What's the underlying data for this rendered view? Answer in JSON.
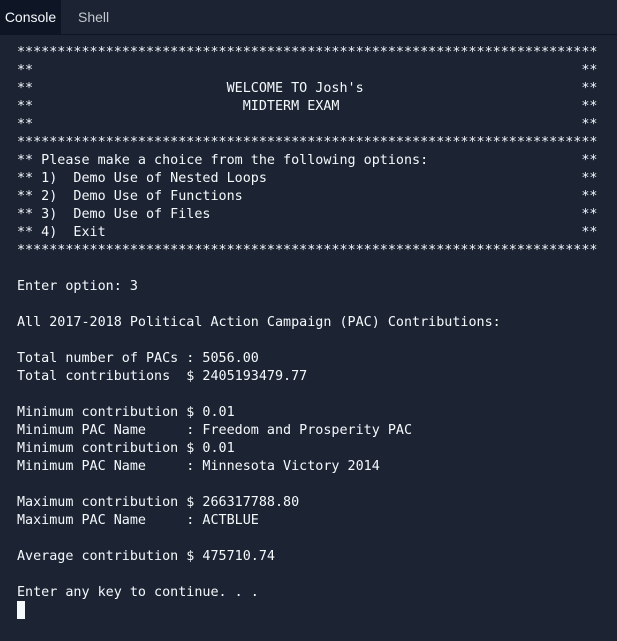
{
  "tabs": [
    {
      "label": "Console",
      "active": true
    },
    {
      "label": "Shell",
      "active": false
    }
  ],
  "console": {
    "lines": [
      "************************************************************************",
      "**                                                                    **",
      "**                        WELCOME TO Josh's                           **",
      "**                          MIDTERM EXAM                              **",
      "**                                                                    **",
      "************************************************************************",
      "** Please make a choice from the following options:                   **",
      "** 1)  Demo Use of Nested Loops                                       **",
      "** 2)  Demo Use of Functions                                          **",
      "** 3)  Demo Use of Files                                              **",
      "** 4)  Exit                                                           **",
      "************************************************************************",
      "",
      "Enter option: 3",
      "",
      "All 2017-2018 Political Action Campaign (PAC) Contributions:",
      "",
      "Total number of PACs : 5056.00",
      "Total contributions  $ 2405193479.77",
      "",
      "Minimum contribution $ 0.01",
      "Minimum PAC Name     : Freedom and Prosperity PAC",
      "Minimum contribution $ 0.01",
      "Minimum PAC Name     : Minnesota Victory 2014",
      "",
      "Maximum contribution $ 266317788.80",
      "Maximum PAC Name     : ACTBLUE",
      "",
      "Average contribution $ 475710.74",
      "",
      "Enter any key to continue. . ."
    ]
  },
  "colors": {
    "background": "#1c2333",
    "active_tab": "#0e1525",
    "text": "#f5f9fc"
  }
}
